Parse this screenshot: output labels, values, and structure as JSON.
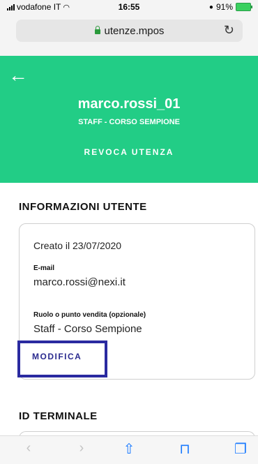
{
  "status_bar": {
    "carrier": "vodafone IT",
    "time": "16:55",
    "battery": "91%"
  },
  "browser": {
    "url": "utenze.mpos"
  },
  "header": {
    "username": "marco.rossi_01",
    "role": "STAFF - CORSO SEMPIONE",
    "revoke_label": "REVOCA UTENZA"
  },
  "info": {
    "section_title": "INFORMAZIONI UTENTE",
    "created": "Creato il 23/07/2020",
    "email_label": "E-mail",
    "email_value": "marco.rossi@nexi.it",
    "role_label": "Ruolo o punto vendita (opzionale)",
    "role_value": "Staff - Corso Sempione",
    "edit_label": "MODIFICA"
  },
  "terminal": {
    "section_title": "ID TERMINALE"
  },
  "toolbar": {
    "back_icon": "chevron-left-icon",
    "forward_icon": "chevron-right-icon",
    "share_icon": "share-icon",
    "bookmarks_icon": "book-icon",
    "tabs_icon": "tabs-icon"
  }
}
